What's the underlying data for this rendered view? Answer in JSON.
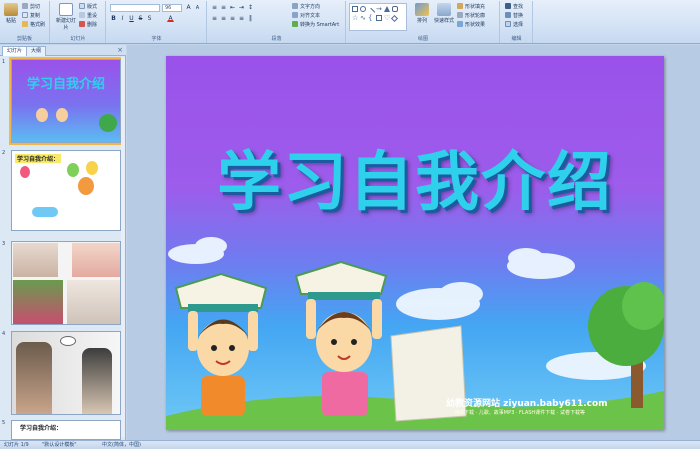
{
  "ribbon": {
    "clipboard": {
      "label": "剪贴板",
      "paste": "粘贴",
      "cut": "剪切",
      "copy": "复制",
      "format_painter": "格式刷"
    },
    "slides": {
      "label": "幻灯片",
      "new_slide": "新建幻灯片",
      "layout": "版式",
      "reset": "重设",
      "delete": "删除"
    },
    "font": {
      "label": "字体",
      "font_name": "",
      "font_size": "96"
    },
    "paragraph": {
      "label": "段落",
      "text_direction": "文字方向",
      "align_text": "对齐文本",
      "smartart": "转换为 SmartArt"
    },
    "drawing": {
      "label": "绘图",
      "arrange": "排列",
      "quick_styles": "快速样式",
      "shape_fill": "形状填充",
      "shape_outline": "形状轮廓",
      "shape_effects": "形状效果"
    },
    "editing": {
      "label": "编辑",
      "find": "查找",
      "replace": "替换",
      "select": "选择"
    }
  },
  "left_panel": {
    "tabs": {
      "slides": "幻灯片",
      "outline": "大纲"
    },
    "close": "×",
    "thumbnails": [
      {
        "num": "1",
        "title": "学习自我介绍"
      },
      {
        "num": "2",
        "title": "学习自我介绍："
      },
      {
        "num": "3",
        "title": ""
      },
      {
        "num": "4",
        "title": ""
      },
      {
        "num": "5",
        "title": "学习自我介绍："
      }
    ]
  },
  "slide": {
    "title": "学习自我介绍",
    "watermark": "幼教资源网站  ziyuan.baby611.com",
    "watermark_sub": "课件下载 · 儿歌、故事MP3 · FLASH课件下载 · 试卷下载等"
  },
  "statusbar": {
    "slide_info": "幻灯片 1/9",
    "theme": "\"默认设计模板\"",
    "language": "中文(简体，中国)"
  },
  "colors": {
    "slide_top": "#9a52ea",
    "slide_bottom": "#6fc9f4",
    "title": "#2ed0ec",
    "ribbon": "#d4e3f5"
  }
}
